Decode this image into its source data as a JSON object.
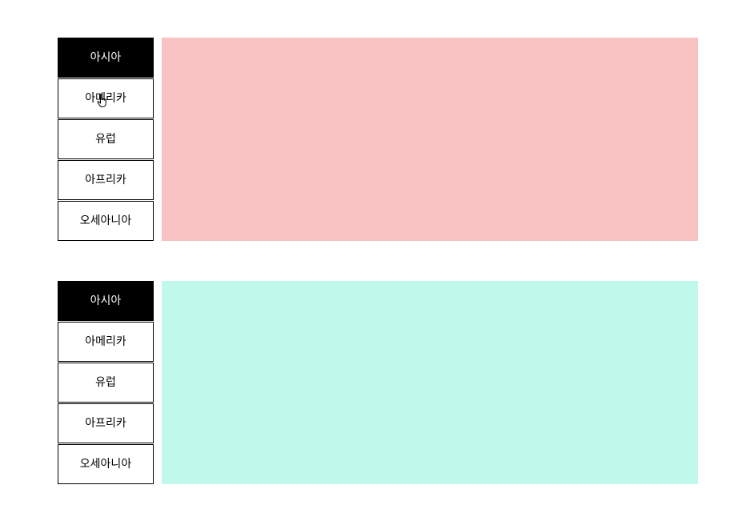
{
  "tab_groups": [
    {
      "tabs": [
        "아시아",
        "아메리카",
        "유럽",
        "아프리카",
        "오세아니아"
      ],
      "active_index": 0,
      "panel_color": "#f9c2c2"
    },
    {
      "tabs": [
        "아시아",
        "아메리카",
        "유럽",
        "아프리카",
        "오세아니아"
      ],
      "active_index": 0,
      "panel_color": "#c0f8ec"
    }
  ],
  "cursor": {
    "icon": "hand-pointer-icon"
  }
}
